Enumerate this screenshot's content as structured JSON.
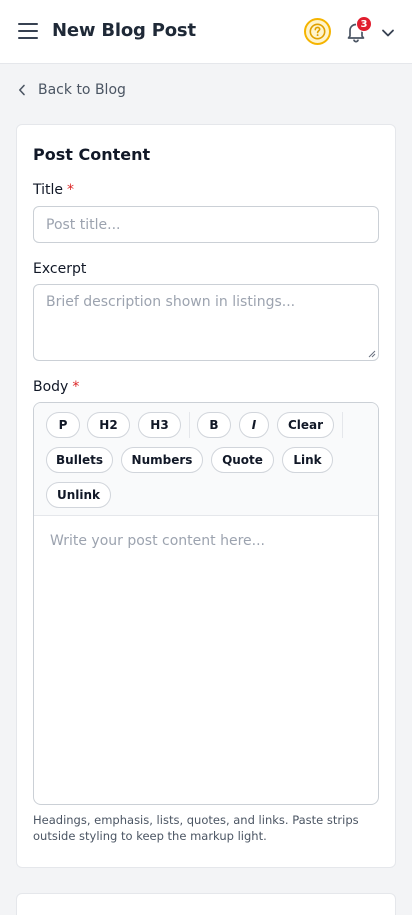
{
  "header": {
    "title": "New Blog Post",
    "notification_count": "3",
    "accent_color": "#f5b400",
    "badge_color": "#e11d2e",
    "icons": [
      "hamburger-icon",
      "help-icon",
      "bell-icon",
      "chevron-down-icon"
    ]
  },
  "nav": {
    "back_label": "Back to Blog"
  },
  "post_content": {
    "section_title": "Post Content",
    "required_mark": "*",
    "title_field": {
      "label": "Title",
      "placeholder": "Post title...",
      "value": ""
    },
    "excerpt_field": {
      "label": "Excerpt",
      "placeholder": "Brief description shown in listings...",
      "value": ""
    },
    "body_field": {
      "label": "Body",
      "placeholder": "Write your post content here...",
      "helper": "Headings, emphasis, lists, quotes, and links. Paste strips outside styling to keep the markup light."
    },
    "toolbar": {
      "p": "P",
      "h2": "H2",
      "h3": "H3",
      "bold": "B",
      "italic": "I",
      "clear": "Clear",
      "bullets": "Bullets",
      "numbers": "Numbers",
      "quote": "Quote",
      "link": "Link",
      "unlink": "Unlink"
    }
  }
}
